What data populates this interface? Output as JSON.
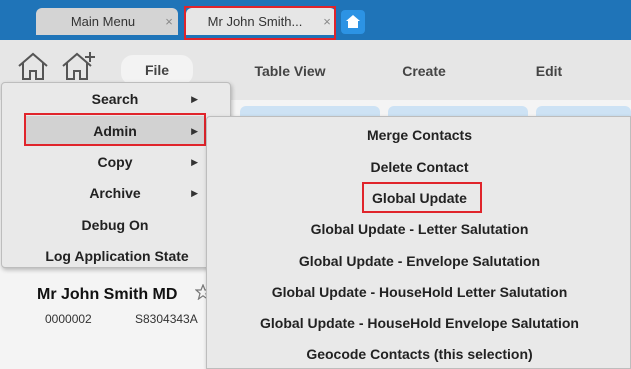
{
  "tabs": [
    {
      "label": "Main Menu",
      "close": "×"
    },
    {
      "label": "Mr John Smith...",
      "close": "×"
    }
  ],
  "toolbar": {
    "file_label": "File",
    "table_view_label": "Table View",
    "create_label": "Create",
    "edit_label": "Edit"
  },
  "file_menu": {
    "items": [
      {
        "label": "Search",
        "arrow": "▶"
      },
      {
        "label": "Admin",
        "arrow": "▶"
      },
      {
        "label": "Copy",
        "arrow": "▶"
      },
      {
        "label": "Archive",
        "arrow": "▶"
      },
      {
        "label": "Debug On"
      },
      {
        "label": "Log Application State"
      }
    ]
  },
  "admin_submenu": {
    "items": [
      "Merge Contacts",
      "Delete Contact",
      "Global Update",
      "Global Update - Letter Salutation",
      "Global Update - Envelope Salutation",
      "Global Update - HouseHold Letter Salutation",
      "Global Update - HouseHold Envelope Salutation",
      "Geocode Contacts (this selection)"
    ]
  },
  "contact": {
    "name": "Mr John Smith MD",
    "id": "0000002",
    "ref": "S8304343A"
  },
  "colors": {
    "tab_strip": "#1f74b8",
    "highlight": "#e0242b",
    "new_tab_button": "#2c93e4"
  },
  "icons": [
    "home-icon",
    "home-add-icon",
    "close-icon",
    "new-tab-icon",
    "star-icon",
    "chevron-right-icon"
  ]
}
